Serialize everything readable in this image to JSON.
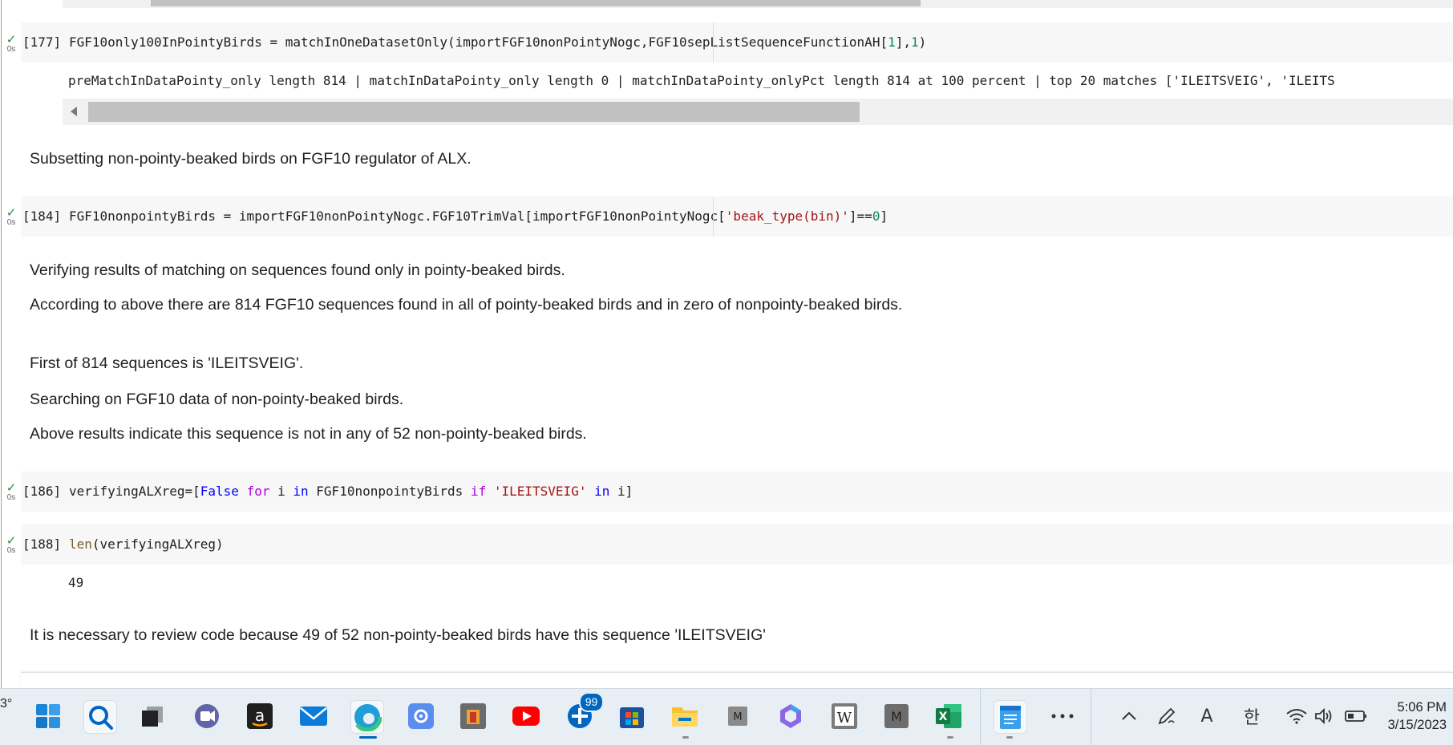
{
  "cells": [
    {
      "exec": "[177]",
      "time": "0s",
      "code_parts": [
        "FGF10only100InPointyBirds = matchInOneDatasetOnly(importFGF10nonPointyNogc,FGF10sepListSequenceFunctionAH[",
        "1",
        "],",
        "1",
        ")"
      ],
      "output": "preMatchInDataPointy_only length  814  | matchInDataPointy_only length  0  | matchInDataPointy_onlyPct length  814  at  100  percent | top 20 matches  ['ILEITSVEIG', 'ILEITS"
    },
    {
      "exec": "[184]",
      "time": "0s",
      "code_parts": [
        "FGF10nonpointyBirds = importFGF10nonPointyNogc.FGF10TrimVal[importFGF10nonPointyNogc[",
        "'beak_type(bin)'",
        "]==",
        "0",
        "]"
      ]
    },
    {
      "exec": "[186]",
      "time": "0s",
      "code_parts": [
        "verifyingALXreg=[",
        "False",
        " ",
        "for",
        " i ",
        "in",
        " FGF10nonpointyBirds ",
        "if",
        " ",
        "'ILEITSVEIG'",
        " ",
        "in",
        " i]"
      ]
    },
    {
      "exec": "[188]",
      "time": "0s",
      "code_parts": [
        "len",
        "(verifyingALXreg)"
      ],
      "output": "49"
    }
  ],
  "markdown": {
    "subsetting": "Subsetting non-pointy-beaked birds on FGF10 regulator of ALX.",
    "verifying": "Verifying results of matching on sequences found only in pointy-beaked birds.",
    "according": "According to above there are 814 FGF10 sequences found in all of pointy-beaked birds and in zero of nonpointy-beaked birds.",
    "first": "First of 814 sequences is 'ILEITSVEIG'.",
    "searching": "Searching on FGF10 data of non-pointy-beaked birds.",
    "above": "Above results indicate this sequence is not in any of 52 non-pointy-beaked birds.",
    "necessary": "It is necessary to review code because 49 of 52 non-pointy-beaked birds have this sequence 'ILEITSVEIG'"
  },
  "taskbar": {
    "weather_fragment": "3°",
    "notification_badge": "99",
    "ime_label": "A",
    "ime_korean": "한",
    "time": "5:06 PM",
    "date": "3/15/2023",
    "icons": [
      "start-icon",
      "search-icon",
      "task-view-icon",
      "teams-chat-icon",
      "amazon-icon",
      "mail-icon",
      "edge-icon",
      "settings-icon",
      "store-bag-icon",
      "youtube-icon",
      "news-badge-icon",
      "ms-store-icon",
      "file-explorer-icon",
      "app-m-small-icon",
      "copilot-icon",
      "wikipedia-icon",
      "app-m-icon",
      "excel-icon",
      "notepad-icon",
      "more-icon"
    ]
  },
  "colors": {
    "code_bg": "#f7f7f7",
    "check": "#1e8e3e",
    "number": "#098658",
    "string": "#a31515",
    "keyword": "#0000ff",
    "control_keyword": "#af00db",
    "function": "#795e26",
    "taskbar_bg": "#e7eef4",
    "accent": "#0067c0"
  }
}
